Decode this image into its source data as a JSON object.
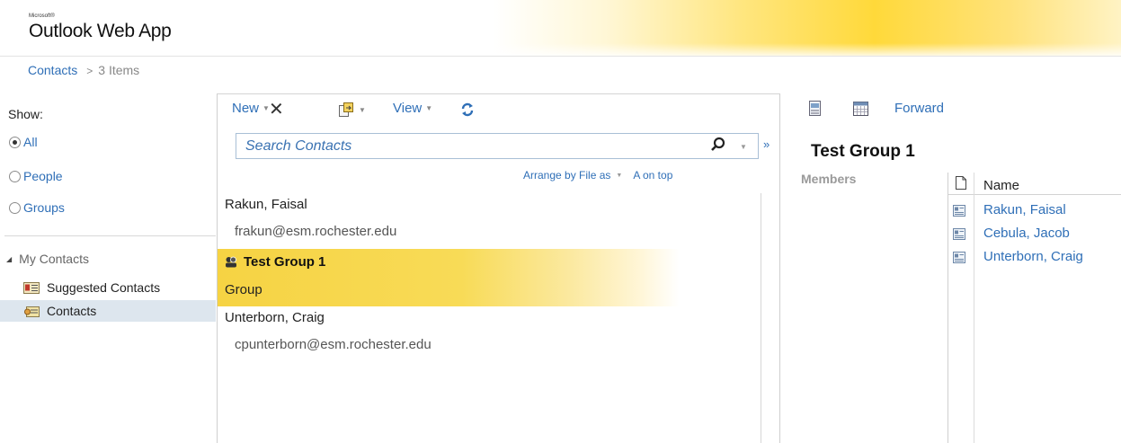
{
  "app": {
    "brand_small": "Microsoft®",
    "brand_title": "Outlook Web App"
  },
  "breadcrumb": {
    "folder": "Contacts",
    "separator": ">",
    "count": "3 Items"
  },
  "nav": {
    "show_label": "Show:",
    "filters": [
      {
        "label": "All",
        "selected": true
      },
      {
        "label": "People",
        "selected": false
      },
      {
        "label": "Groups",
        "selected": false
      }
    ],
    "section_label": "My Contacts",
    "folders": [
      {
        "label": "Suggested Contacts",
        "icon": "suggested-contacts-icon",
        "selected": false
      },
      {
        "label": "Contacts",
        "icon": "contacts-folder-icon",
        "selected": true
      }
    ]
  },
  "toolbar": {
    "new_label": "New",
    "view_label": "View"
  },
  "search": {
    "placeholder": "Search Contacts",
    "value": ""
  },
  "arrange": {
    "by_label": "Arrange by File as",
    "order_label": "A on top"
  },
  "contacts": [
    {
      "name": "Rakun, Faisal",
      "detail": "frakun@esm.rochester.edu",
      "type": "person",
      "selected": false
    },
    {
      "name": "Test Group 1",
      "detail": "Group",
      "type": "group",
      "selected": true
    },
    {
      "name": "Unterborn, Craig",
      "detail": "cpunterborn@esm.rochester.edu",
      "type": "person",
      "selected": false
    }
  ],
  "reading_pane": {
    "forward_label": "Forward",
    "title": "Test Group 1",
    "members_label": "Members",
    "table_header": "Name",
    "members": [
      "Rakun, Faisal",
      "Cebula, Jacob",
      "Unterborn, Craig"
    ]
  },
  "colors": {
    "link": "#2f6fb7",
    "selection": "#f6d343",
    "nav_selected": "#dde6ee"
  }
}
